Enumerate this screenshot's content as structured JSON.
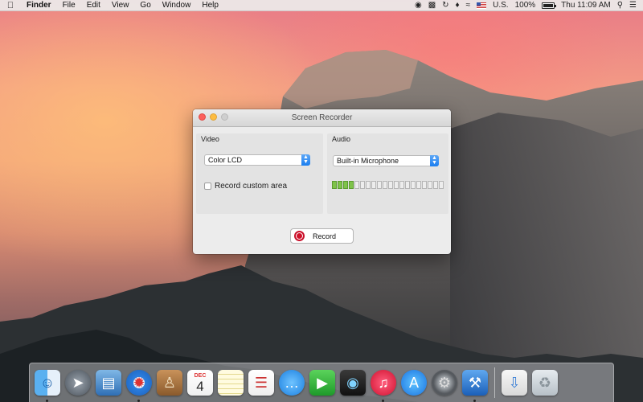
{
  "menubar": {
    "app_name": "Finder",
    "menus": [
      "File",
      "Edit",
      "View",
      "Go",
      "Window",
      "Help"
    ],
    "input_source": "U.S.",
    "battery": "100%",
    "clock": "Thu 11:09 AM",
    "icons": [
      "apple-icon",
      "bluetooth-like-icon",
      "display-icon",
      "time-machine-icon",
      "network-icon",
      "wifi-icon",
      "flag-icon",
      "volume-icon",
      "battery-icon",
      "search-icon",
      "list-icon"
    ]
  },
  "window": {
    "title": "Screen Recorder",
    "video": {
      "label": "Video",
      "display_select": "Color LCD",
      "custom_area_label": "Record custom area",
      "custom_area_checked": false
    },
    "audio": {
      "label": "Audio",
      "input_select": "Built-in Microphone",
      "meter_segments": 20,
      "meter_level": 4
    },
    "record_label": "Record"
  },
  "dock": {
    "icons": [
      {
        "name": "finder-icon",
        "running": true
      },
      {
        "name": "launchpad-icon",
        "running": false
      },
      {
        "name": "preview-icon",
        "running": false
      },
      {
        "name": "safari-icon",
        "running": true
      },
      {
        "name": "contacts-icon",
        "running": false
      },
      {
        "name": "calendar-icon",
        "running": false,
        "month": "DEC",
        "day": "4"
      },
      {
        "name": "notes-icon",
        "running": false
      },
      {
        "name": "reminders-icon",
        "running": false
      },
      {
        "name": "messages-icon",
        "running": false
      },
      {
        "name": "facetime-icon",
        "running": false
      },
      {
        "name": "photo-booth-icon",
        "running": false
      },
      {
        "name": "itunes-icon",
        "running": true
      },
      {
        "name": "app-store-icon",
        "running": false
      },
      {
        "name": "system-preferences-icon",
        "running": false
      },
      {
        "name": "xcode-icon",
        "running": true
      },
      {
        "name": "downloads-stack-icon",
        "running": false
      },
      {
        "name": "trash-icon",
        "running": false
      }
    ]
  }
}
